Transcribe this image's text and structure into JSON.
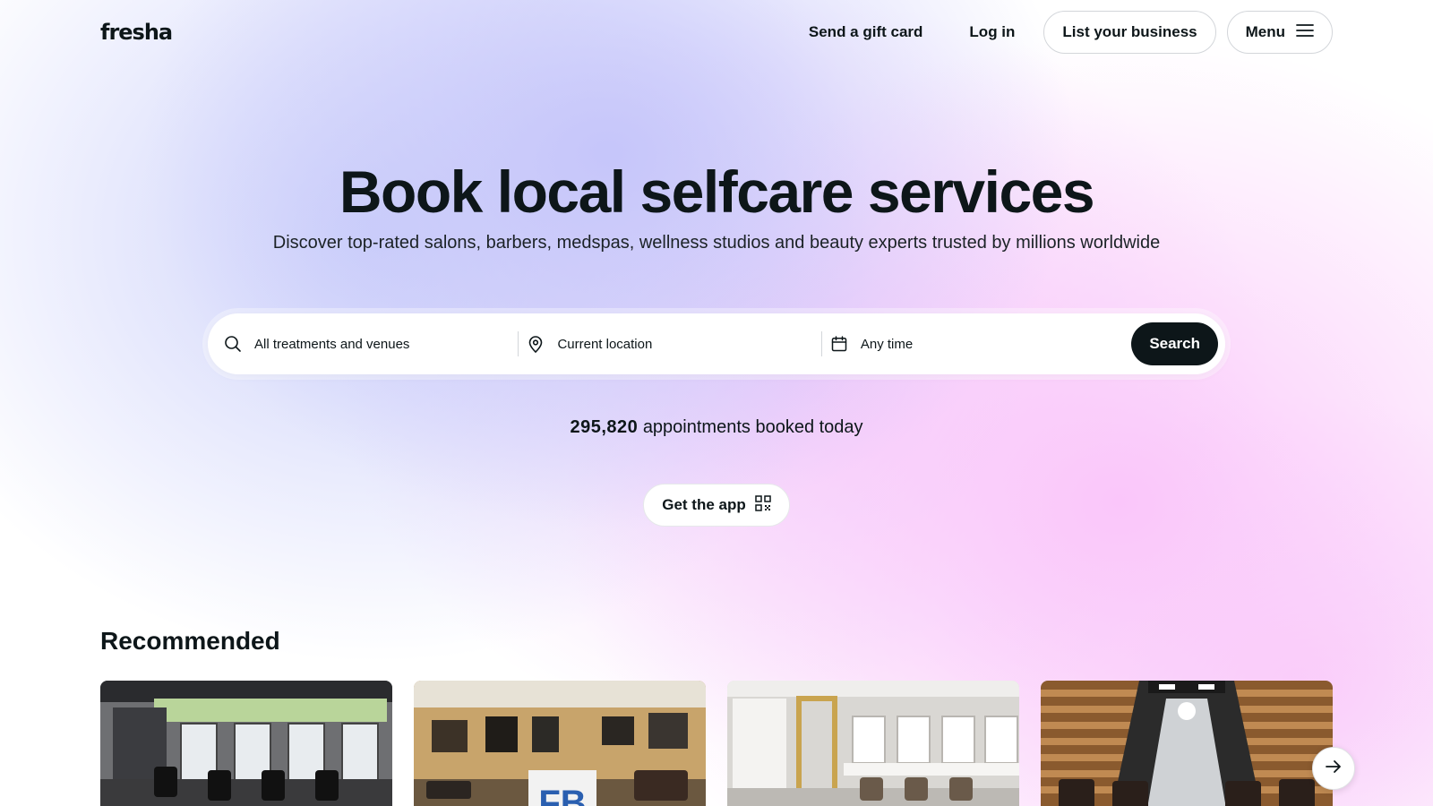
{
  "header": {
    "logo": "fresha",
    "gift_card": "Send a gift card",
    "login": "Log in",
    "list_business": "List your business",
    "menu": "Menu"
  },
  "hero": {
    "title": "Book local selfcare services",
    "subtitle": "Discover top-rated salons, barbers, medspas, wellness studios and beauty experts trusted by millions worldwide"
  },
  "search": {
    "treatments": "All treatments and venues",
    "location": "Current location",
    "time": "Any time",
    "button": "Search"
  },
  "stats": {
    "count": "295,820",
    "label": "appointments booked today"
  },
  "app_button": "Get the app",
  "recommended": {
    "title": "Recommended"
  },
  "icons": [
    "search-icon",
    "location-pin-icon",
    "calendar-icon",
    "menu-icon",
    "qr-code-icon",
    "arrow-right-icon"
  ]
}
